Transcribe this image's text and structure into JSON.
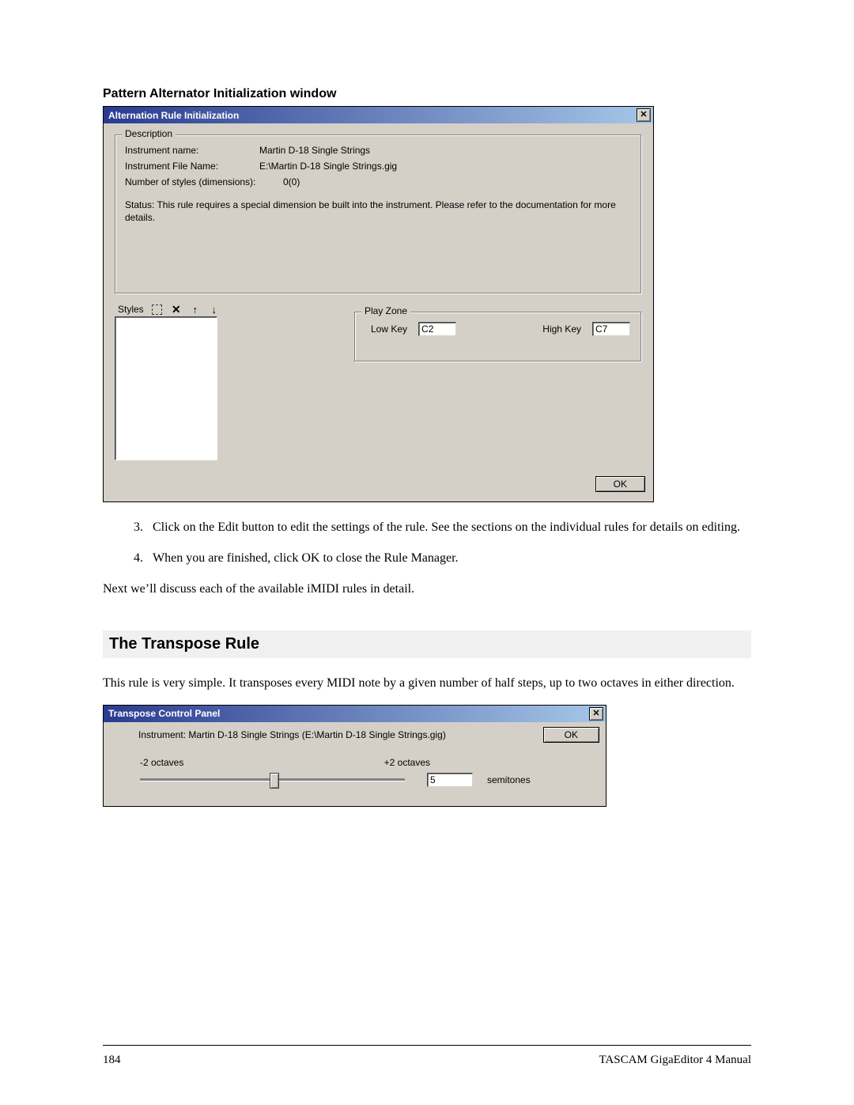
{
  "headings": {
    "pattern_alt": "Pattern Alternator Initialization window",
    "transpose_rule": "The Transpose Rule"
  },
  "dialog1": {
    "title": "Alternation Rule Initialization",
    "close_glyph": "✕",
    "description_legend": "Description",
    "fields": {
      "instr_name_label": "Instrument name:",
      "instr_name_value": "Martin D-18 Single Strings",
      "instr_file_label": "Instrument File Name:",
      "instr_file_value": "E:\\Martin D-18 Single Strings.gig",
      "styles_dim_label": "Number of styles (dimensions):",
      "styles_dim_value": "0(0)",
      "status_text": "Status: This rule requires a special dimension be built into the instrument. Please refer to the documentation for more details."
    },
    "styles_label": "Styles",
    "playzone": {
      "legend": "Play Zone",
      "low_key_label": "Low Key",
      "low_key_value": "C2",
      "high_key_label": "High Key",
      "high_key_value": "C7"
    },
    "ok_label": "OK"
  },
  "list_items": {
    "step3": "Click on the Edit button to edit the settings of the rule.  See the sections on the individual rules for details on editing.",
    "step4": "When you are finished, click OK to close the Rule Manager."
  },
  "paragraphs": {
    "next": "Next we’ll discuss each of the available iMIDI rules in detail.",
    "transpose": "This rule is very simple.  It transposes every MIDI note by a given number of half steps, up to two octaves in either direction."
  },
  "dialog2": {
    "title": "Transpose Control Panel",
    "close_glyph": "✕",
    "instrument_line": "Instrument: Martin D-18 Single Strings (E:\\Martin D-18 Single Strings.gig)",
    "ok_label": "OK",
    "minus_label": "-2 octaves",
    "plus_label": "+2 octaves",
    "semitones_value": "5",
    "semitones_label": "semitones"
  },
  "footer": {
    "page_number": "184",
    "manual_title": "TASCAM GigaEditor 4 Manual"
  }
}
